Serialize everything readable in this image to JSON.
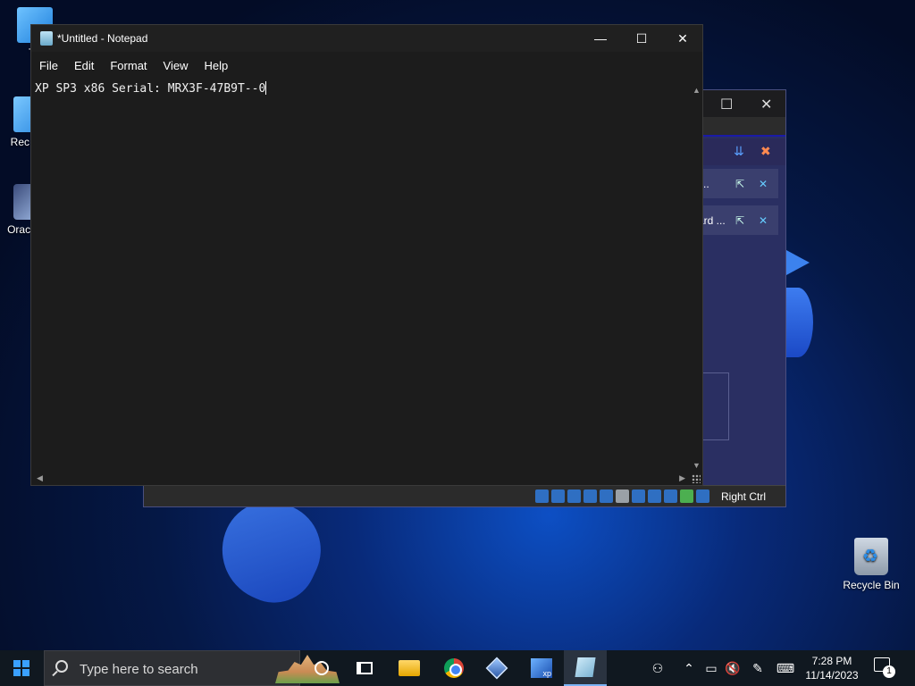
{
  "desktop": {
    "icons": [
      {
        "label": "Th"
      },
      {
        "label": "Rec Con"
      },
      {
        "label": "Orac Virtu"
      },
      {
        "label": "Recycle Bin"
      }
    ]
  },
  "vbox_window": {
    "row1_label": "..",
    "row2_label": "ard ...",
    "status_right": "Right Ctrl"
  },
  "notepad": {
    "title": "*Untitled - Notepad",
    "menu": [
      "File",
      "Edit",
      "Format",
      "View",
      "Help"
    ],
    "content": "XP SP3 x86 Serial: MRX3F-47B9T--0",
    "controls": {
      "minimize": "—",
      "maximize": "☐",
      "close": "✕"
    }
  },
  "taskbar": {
    "search_placeholder": "Type here to search",
    "time": "7:28 PM",
    "date": "11/14/2023",
    "notification_count": "1",
    "pinned": [
      "cortana-icon",
      "task-view-icon",
      "file-explorer-icon",
      "chrome-icon",
      "virtualbox-icon",
      "windows-xp-vm-icon",
      "notepad-icon"
    ]
  }
}
